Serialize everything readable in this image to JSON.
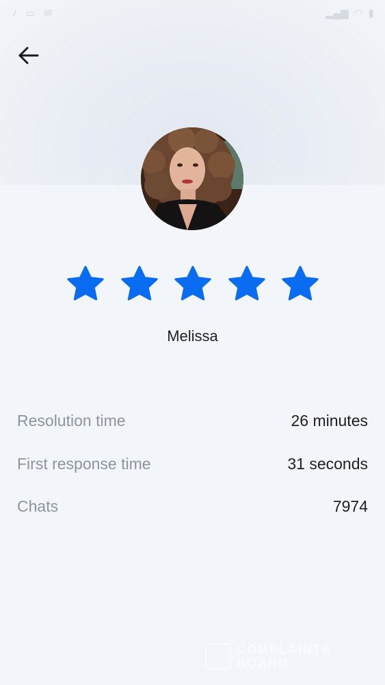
{
  "status_bar": {
    "left_icons": [
      "music-note-icon",
      "sim-icon",
      "message-icon"
    ],
    "right_icons": [
      "signal-icon",
      "wifi-icon",
      "battery-icon"
    ]
  },
  "header": {
    "back_icon": "arrow-left-icon"
  },
  "agent": {
    "name": "Melissa",
    "rating": 5,
    "rating_max": 5,
    "star_color": "#0a6cf0"
  },
  "stats": [
    {
      "label": "Resolution time",
      "value": "26 minutes"
    },
    {
      "label": "First response time",
      "value": "31 seconds"
    },
    {
      "label": "Chats",
      "value": "7974"
    }
  ],
  "watermark": {
    "line1": "COMPLAINTS",
    "line2": "BOARD"
  }
}
